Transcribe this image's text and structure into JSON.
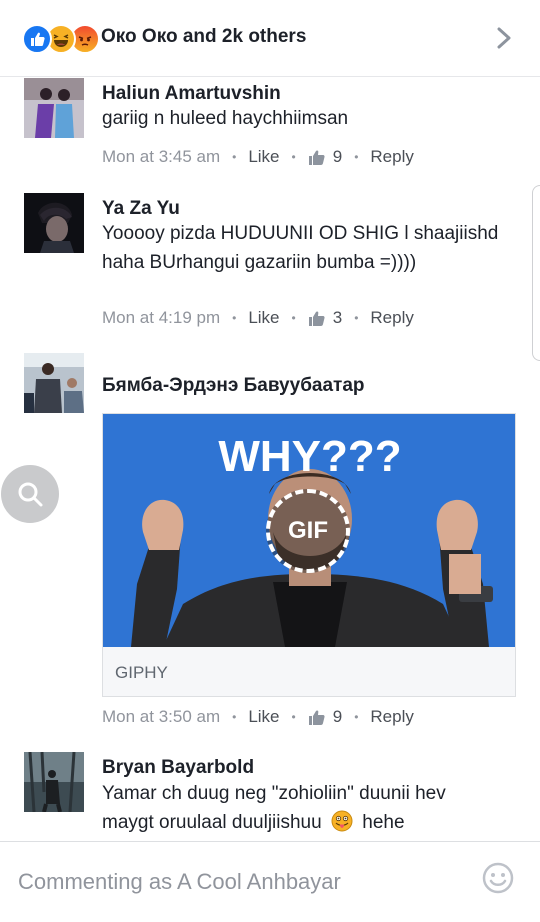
{
  "header": {
    "reactors_text": "Око Око and 2k others",
    "reaction_icons": [
      "like-icon",
      "haha-icon",
      "angry-icon"
    ],
    "chevron_icon": "chevron-right-icon"
  },
  "comments": [
    {
      "author": "Haliun Amartuvshin",
      "text": "gariig n huleed haychhiimsan",
      "time": "Mon at 3:45 am",
      "like_label": "Like",
      "like_count": "9",
      "reply_label": "Reply"
    },
    {
      "author": "Ya Za Yu",
      "text": "Yooooy pizda HUDUUNII OD SHIG l shaajiishd haha BUrhangui gazariin bumba =))))",
      "time": "Mon at 4:19 pm",
      "like_label": "Like",
      "like_count": "3",
      "reply_label": "Reply"
    },
    {
      "author": "Бямба-Эрдэнэ Бавуубаатар",
      "gif": {
        "caption": "WHY???",
        "badge": "GIF",
        "source": "GIPHY"
      },
      "time": "Mon at 3:50 am",
      "like_label": "Like",
      "like_count": "9",
      "reply_label": "Reply"
    },
    {
      "author": "Bryan Bayarbold",
      "text_line1": "Yamar ch duug neg \"zohioliin\" duunii hev",
      "text_line2_before": "maygt oruulaal duuljiishuu",
      "text_line2_after": "hehe"
    }
  ],
  "composer": {
    "placeholder": "Commenting as A Cool Anhbayar",
    "emoji_icon": "smiley-icon"
  },
  "side_button_icon": "search-icon",
  "colors": {
    "brand_blue": "#1877f2",
    "meta_gray": "#90949c",
    "gif_bg": "#2f74d3"
  }
}
